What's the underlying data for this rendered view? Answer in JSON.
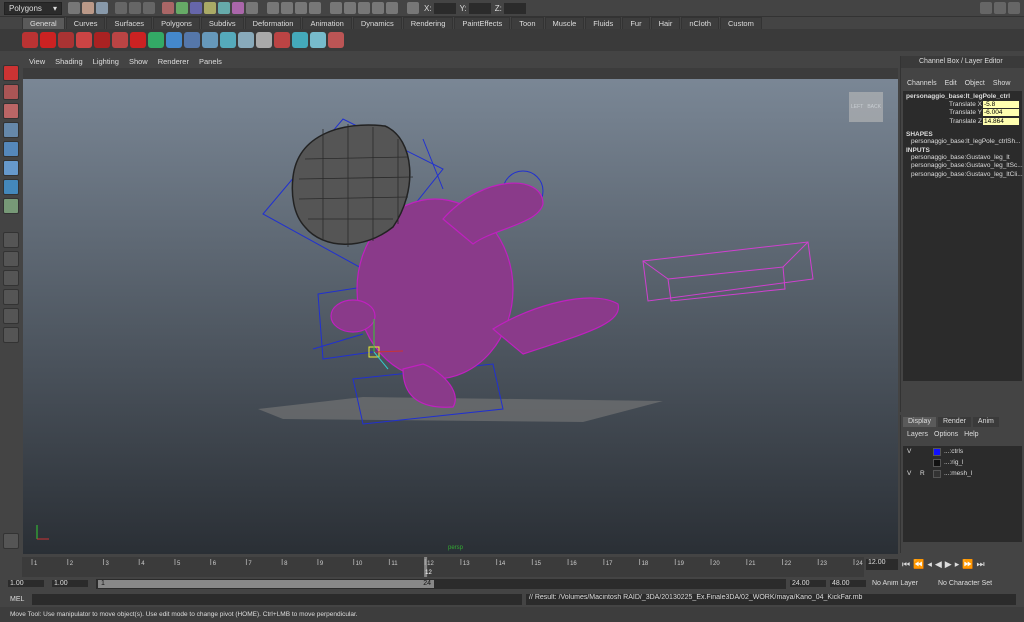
{
  "status_line": {
    "menu_set": "Polygons",
    "x_label": "X:",
    "y_label": "Y:",
    "z_label": "Z:"
  },
  "shelf_tabs": [
    "General",
    "Curves",
    "Surfaces",
    "Polygons",
    "Subdivs",
    "Deformation",
    "Animation",
    "Dynamics",
    "Rendering",
    "PaintEffects",
    "Toon",
    "Muscle",
    "Fluids",
    "Fur",
    "Hair",
    "nCloth",
    "Custom"
  ],
  "viewport": {
    "menus": [
      "View",
      "Shading",
      "Lighting",
      "Show",
      "Renderer",
      "Panels"
    ],
    "cube_left": "LEFT",
    "cube_right": "BACK",
    "camera_label": "persp"
  },
  "channel_box": {
    "title": "Channel Box / Layer Editor",
    "menus": [
      "Channels",
      "Edit",
      "Object",
      "Show"
    ],
    "object": "personaggio_base:lt_legPole_ctrl",
    "attrs": [
      {
        "name": "Translate X",
        "value": "-5.8"
      },
      {
        "name": "Translate Y",
        "value": "-6.004"
      },
      {
        "name": "Translate Z",
        "value": "14.864"
      }
    ],
    "shapes_header": "SHAPES",
    "shape": "personaggio_base:lt_legPole_ctrlSh...",
    "inputs_header": "INPUTS",
    "inputs": [
      "personaggio_base:Gustavo_leg_lt",
      "personaggio_base:Gustavo_leg_ltSc...",
      "personaggio_base:Gustavo_leg_ltCli..."
    ]
  },
  "layer_editor": {
    "tabs": [
      "Display",
      "Render",
      "Anim"
    ],
    "menus": [
      "Layers",
      "Options",
      "Help"
    ],
    "layers": [
      {
        "v": "V",
        "p": "",
        "name": "...:ctrls",
        "color": "#1010ff"
      },
      {
        "v": "",
        "p": "",
        "name": "...:rig_l",
        "color": "#111111"
      },
      {
        "v": "V",
        "p": "R",
        "name": "...:mesh_l",
        "color": "#333333"
      }
    ]
  },
  "time_slider": {
    "ticks": [
      "1",
      "2",
      "3",
      "4",
      "5",
      "6",
      "7",
      "8",
      "9",
      "10",
      "11",
      "12",
      "13",
      "14",
      "15",
      "16",
      "17",
      "18",
      "19",
      "20",
      "21",
      "22",
      "23",
      "24"
    ],
    "current": "12",
    "current_field": "12.00"
  },
  "range_slider": {
    "start": "1.00",
    "inner_start": "1.00",
    "range_start": "1",
    "range_end": "24",
    "inner_end": "24.00",
    "end": "48.00",
    "anim_layer": "No Anim Layer",
    "char_set": "No Character Set"
  },
  "command_line": {
    "label": "MEL",
    "result": "// Result: /Volumes/Macintosh RAID/_3DA/20130225_Ex.Finale3DA/02_WORK/maya/Kano_04_KickFar.mb"
  },
  "help_line": "Move Tool: Use manipulator to move object(s). Use edit mode to change pivot (HOME).  Ctrl+LMB to move perpendicular."
}
